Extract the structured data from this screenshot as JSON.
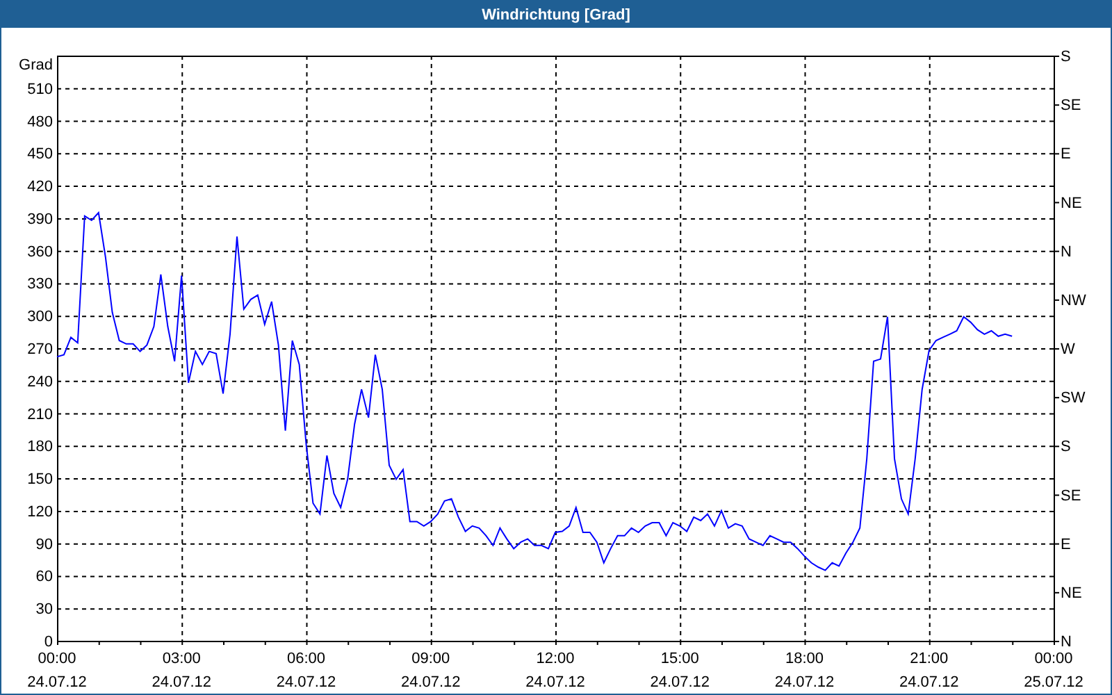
{
  "window": {
    "title": "Windrichtung [Grad]"
  },
  "chart": {
    "chart_data": {
      "type": "line",
      "grid": true,
      "ylabel": "Grad",
      "ylim": [
        0,
        540
      ],
      "yticks": [
        0,
        30,
        60,
        90,
        120,
        150,
        180,
        210,
        240,
        270,
        300,
        330,
        360,
        390,
        420,
        450,
        480,
        510
      ],
      "categories": [
        "00:00\n24.07.12",
        null,
        null,
        null,
        null,
        null,
        null,
        null,
        null,
        null,
        null,
        null,
        null,
        null,
        null,
        null,
        null,
        null,
        "03:00\n24.07.12",
        null,
        null,
        null,
        null,
        null,
        null,
        null,
        null,
        null,
        null,
        null,
        null,
        null,
        null,
        null,
        null,
        null,
        "06:00\n24.07.12",
        null,
        null,
        null,
        null,
        null,
        null,
        null,
        null,
        null,
        null,
        null,
        null,
        null,
        null,
        null,
        null,
        null,
        "09:00\n24.07.12",
        null,
        null,
        null,
        null,
        null,
        null,
        null,
        null,
        null,
        null,
        null,
        null,
        null,
        null,
        null,
        null,
        null,
        "12:00\n24.07.12",
        null,
        null,
        null,
        null,
        null,
        null,
        null,
        null,
        null,
        null,
        null,
        null,
        null,
        null,
        null,
        null,
        null,
        "15:00\n24.07.12",
        null,
        null,
        null,
        null,
        null,
        null,
        null,
        null,
        null,
        null,
        null,
        null,
        null,
        null,
        null,
        null,
        null,
        "18:00\n24.07.12",
        null,
        null,
        null,
        null,
        null,
        null,
        null,
        null,
        null,
        null,
        null,
        null,
        null,
        null,
        null,
        null,
        null,
        "21:00\n24.07.12",
        null,
        null,
        null,
        null,
        null,
        null,
        null,
        null,
        null,
        null,
        null,
        null,
        null,
        null,
        null,
        null,
        null,
        "00:00\n25.07.12"
      ],
      "series": [
        {
          "color": "#0000ff",
          "values": [
            262,
            264,
            280,
            275,
            392,
            388,
            395,
            354,
            303,
            277,
            274,
            274,
            267,
            273,
            290,
            338,
            290,
            258,
            337,
            238,
            267,
            255,
            267,
            265,
            228,
            283,
            373,
            306,
            315,
            319,
            292,
            313,
            273,
            194,
            277,
            255,
            181,
            127,
            117,
            171,
            136,
            123,
            149,
            200,
            232,
            206,
            264,
            232,
            162,
            149,
            158,
            110,
            110,
            106,
            110,
            117,
            129,
            131,
            114,
            101,
            106,
            104,
            97,
            88,
            104,
            94,
            85,
            91,
            94,
            88,
            88,
            85,
            100,
            101,
            106,
            123,
            100,
            100,
            91,
            72,
            85,
            97,
            97,
            104,
            100,
            106,
            109,
            109,
            97,
            109,
            106,
            101,
            114,
            111,
            117,
            106,
            120,
            104,
            108,
            106,
            94,
            91,
            88,
            97,
            94,
            91,
            91,
            85,
            78,
            72,
            68,
            65,
            72,
            69,
            81,
            91,
            104,
            168,
            258,
            260,
            299,
            168,
            131,
            117,
            168,
            232,
            268,
            277,
            280,
            283,
            286,
            299,
            294,
            287,
            283,
            286,
            281,
            283,
            281,
            null,
            null,
            null,
            null,
            null,
            null
          ]
        }
      ]
    },
    "right_axis": {
      "labels": [
        "S",
        "SE",
        "E",
        "NE",
        "N",
        "NW",
        "W",
        "SW",
        "S",
        "SE",
        "E",
        "NE",
        "N"
      ]
    }
  }
}
